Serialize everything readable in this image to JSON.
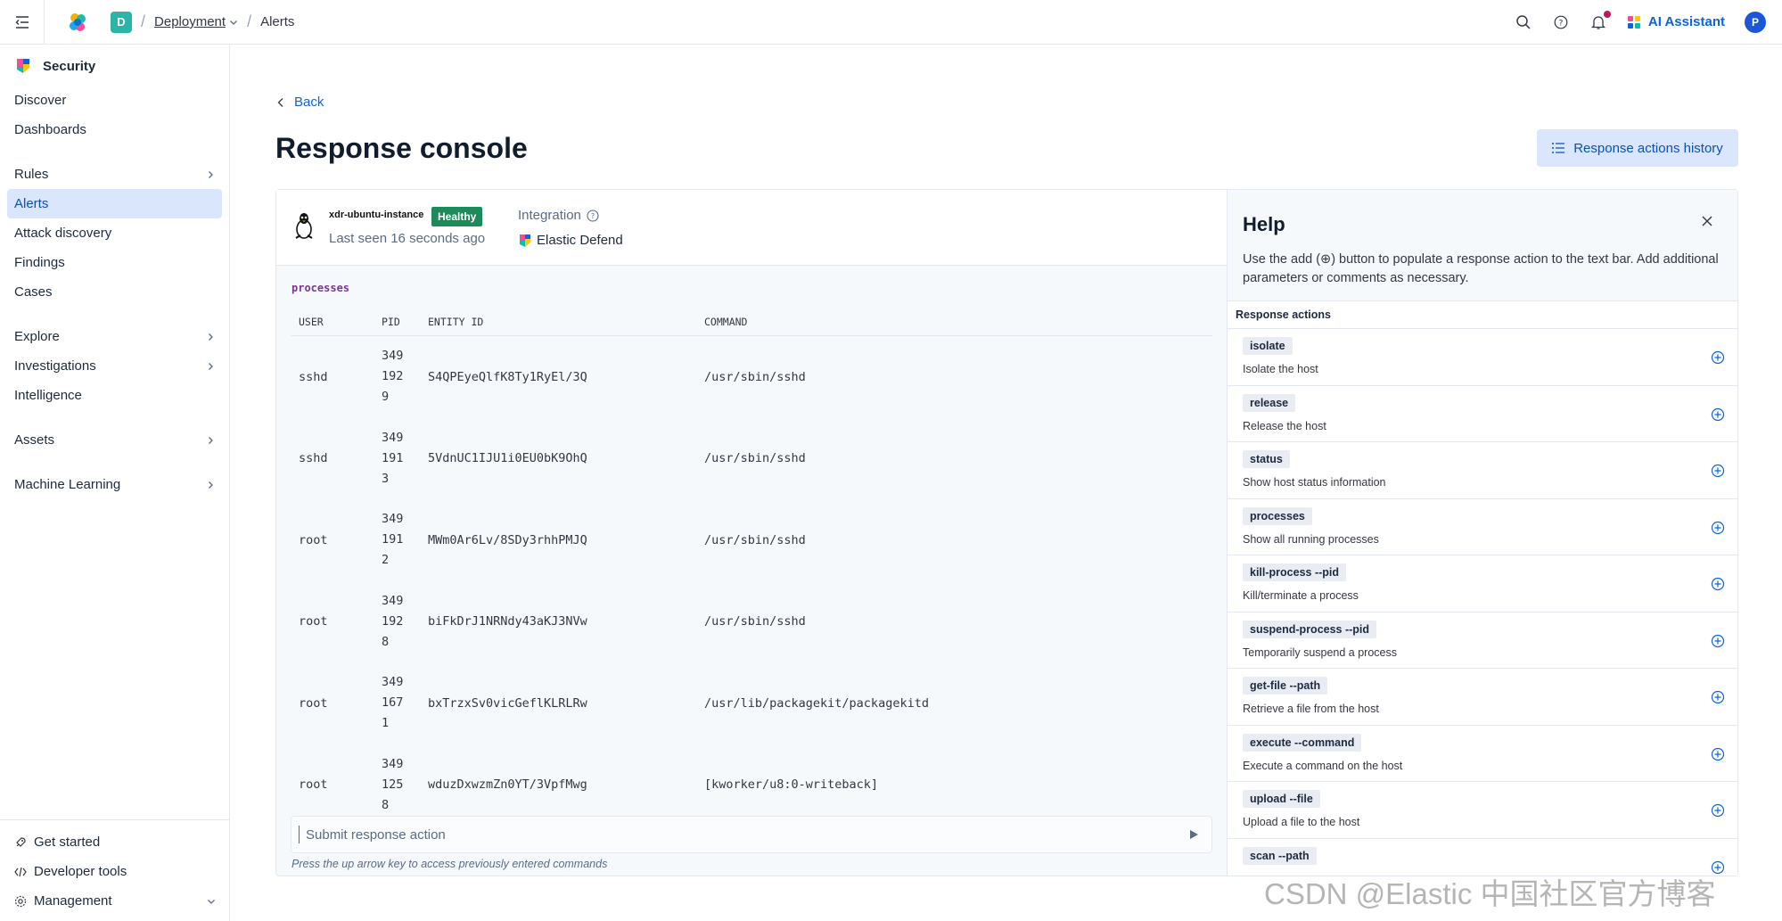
{
  "topbar": {
    "space_initial": "D",
    "breadcrumb": [
      "Deployment",
      "Alerts"
    ],
    "ai_assistant": "AI Assistant",
    "avatar_initial": "P"
  },
  "sidebar": {
    "title": "Security",
    "items": [
      {
        "label": "Discover"
      },
      {
        "label": "Dashboards"
      },
      {
        "label": "Rules"
      },
      {
        "label": "Alerts"
      },
      {
        "label": "Attack discovery"
      },
      {
        "label": "Findings"
      },
      {
        "label": "Cases"
      },
      {
        "label": "Explore"
      },
      {
        "label": "Investigations"
      },
      {
        "label": "Intelligence"
      },
      {
        "label": "Assets"
      },
      {
        "label": "Machine Learning"
      }
    ],
    "bottom": [
      {
        "label": "Get started"
      },
      {
        "label": "Developer tools"
      },
      {
        "label": "Management"
      }
    ]
  },
  "page": {
    "back": "Back",
    "title": "Response console",
    "history_button": "Response actions history"
  },
  "host": {
    "name": "xdr-ubuntu-instance",
    "status": "Healthy",
    "last_seen": "Last seen 16 seconds ago",
    "integration_label": "Integration",
    "integration_value": "Elastic Defend"
  },
  "processes": {
    "command": "processes",
    "headers": [
      "USER",
      "PID",
      "ENTITY ID",
      "COMMAND"
    ],
    "rows": [
      {
        "user": "sshd",
        "pid": "349\n192\n9",
        "entity_id": "S4QPEyeQlfK8Ty1RyEl/3Q",
        "command": "/usr/sbin/sshd"
      },
      {
        "user": "sshd",
        "pid": "349\n191\n3",
        "entity_id": "5VdnUC1IJU1i0EU0bK9OhQ",
        "command": "/usr/sbin/sshd"
      },
      {
        "user": "root",
        "pid": "349\n191\n2",
        "entity_id": "MWm0Ar6Lv/8SDy3rhhPMJQ",
        "command": "/usr/sbin/sshd"
      },
      {
        "user": "root",
        "pid": "349\n192\n8",
        "entity_id": "biFkDrJ1NRNdy43aKJ3NVw",
        "command": "/usr/sbin/sshd"
      },
      {
        "user": "root",
        "pid": "349\n167\n1",
        "entity_id": "bxTrzxSv0vicGeflKLRLRw",
        "command": "/usr/lib/packagekit/packagekitd"
      },
      {
        "user": "root",
        "pid": "349\n125\n8",
        "entity_id": "wduzDxwzmZn0YT/3VpfMwg",
        "command": "[kworker/u8:0-writeback]"
      }
    ]
  },
  "input": {
    "placeholder": "Submit response action",
    "hint": "Press the up arrow key to access previously entered commands"
  },
  "help": {
    "title": "Help",
    "description": "Use the add (⊕) button to populate a response action to the text bar. Add additional parameters or comments as necessary.",
    "actions_title": "Response actions",
    "actions": [
      {
        "code": "isolate",
        "desc": "Isolate the host"
      },
      {
        "code": "release",
        "desc": "Release the host"
      },
      {
        "code": "status",
        "desc": "Show host status information"
      },
      {
        "code": "processes",
        "desc": "Show all running processes"
      },
      {
        "code": "kill-process --pid",
        "desc": "Kill/terminate a process"
      },
      {
        "code": "suspend-process --pid",
        "desc": "Temporarily suspend a process"
      },
      {
        "code": "get-file --path",
        "desc": "Retrieve a file from the host"
      },
      {
        "code": "execute --command",
        "desc": "Execute a command on the host"
      },
      {
        "code": "upload --file",
        "desc": "Upload a file to the host"
      },
      {
        "code": "scan --path",
        "desc": ""
      }
    ]
  },
  "watermark": "CSDN @Elastic 中国社区官方博客",
  "colors": {
    "accent": "#0b64dd",
    "healthy": "#1d8a5a",
    "active_nav": "#d9e6fb"
  }
}
